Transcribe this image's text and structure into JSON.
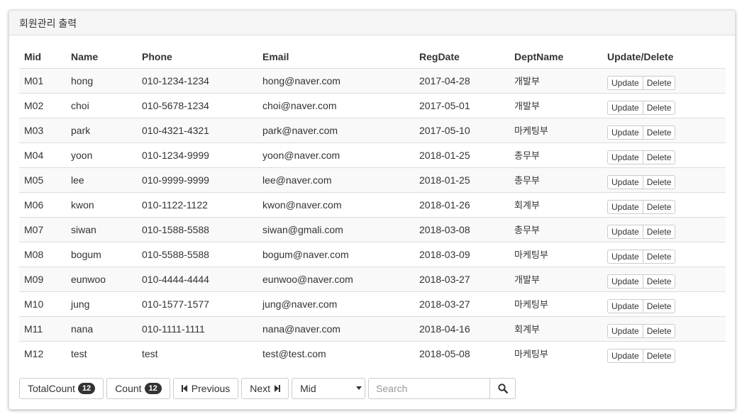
{
  "panel": {
    "title": "회원관리 출력"
  },
  "table": {
    "headers": [
      "Mid",
      "Name",
      "Phone",
      "Email",
      "RegDate",
      "DeptName",
      "Update/Delete"
    ],
    "rows": [
      [
        "M01",
        "hong",
        "010-1234-1234",
        "hong@naver.com",
        "2017-04-28",
        "개발부"
      ],
      [
        "M02",
        "choi",
        "010-5678-1234",
        "choi@naver.com",
        "2017-05-01",
        "개발부"
      ],
      [
        "M03",
        "park",
        "010-4321-4321",
        "park@naver.com",
        "2017-05-10",
        "마케팅부"
      ],
      [
        "M04",
        "yoon",
        "010-1234-9999",
        "yoon@naver.com",
        "2018-01-25",
        "총무부"
      ],
      [
        "M05",
        "lee",
        "010-9999-9999",
        "lee@naver.com",
        "2018-01-25",
        "총무부"
      ],
      [
        "M06",
        "kwon",
        "010-1122-1122",
        "kwon@naver.com",
        "2018-01-26",
        "회계부"
      ],
      [
        "M07",
        "siwan",
        "010-1588-5588",
        "siwan@gmali.com",
        "2018-03-08",
        "총무부"
      ],
      [
        "M08",
        "bogum",
        "010-5588-5588",
        "bogum@naver.com",
        "2018-03-09",
        "마케팅부"
      ],
      [
        "M09",
        "eunwoo",
        "010-4444-4444",
        "eunwoo@naver.com",
        "2018-03-27",
        "개발부"
      ],
      [
        "M10",
        "jung",
        "010-1577-1577",
        "jung@naver.com",
        "2018-03-27",
        "마케팅부"
      ],
      [
        "M11",
        "nana",
        "010-1111-1111",
        "nana@naver.com",
        "2018-04-16",
        "회계부"
      ],
      [
        "M12",
        "test",
        "test",
        "test@test.com",
        "2018-05-08",
        "마케팅부"
      ]
    ],
    "update_label": "Update",
    "delete_label": "Delete"
  },
  "footer": {
    "total_count_label": "TotalCount",
    "total_count": "12",
    "count_label": "Count",
    "count": "12",
    "previous_label": "Previous",
    "next_label": "Next",
    "select_value": "Mid",
    "search_placeholder": "Search"
  },
  "icons": {
    "previous": "step-backward-icon",
    "next": "step-forward-icon",
    "search": "search-icon",
    "select": "chevron-down-icon"
  }
}
